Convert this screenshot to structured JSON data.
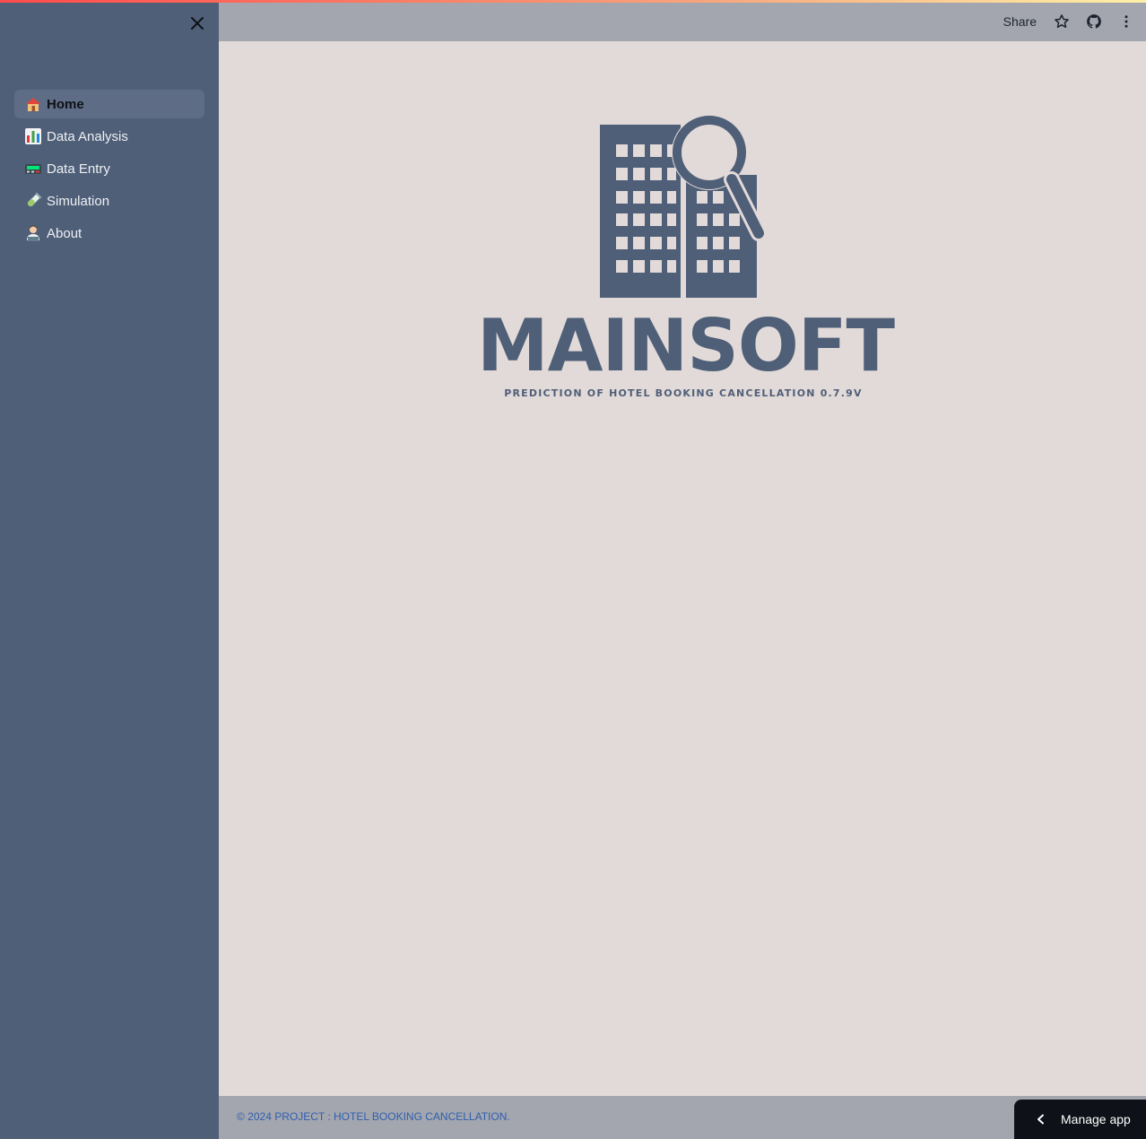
{
  "sidebar": {
    "close_icon": "close-icon",
    "items": [
      {
        "label": "Home",
        "icon": "house-emoji",
        "active": true
      },
      {
        "label": "Data Analysis",
        "icon": "bar-chart-emoji",
        "active": false
      },
      {
        "label": "Data Entry",
        "icon": "pager-emoji",
        "active": false
      },
      {
        "label": "Simulation",
        "icon": "test-tube-emoji",
        "active": false
      },
      {
        "label": "About",
        "icon": "technologist-emoji",
        "active": false
      }
    ]
  },
  "header": {
    "share_label": "Share",
    "icons": [
      "star-icon",
      "github-icon",
      "more-vertical-icon"
    ]
  },
  "logo": {
    "title": "MAINSOFT",
    "subtitle": "PREDICTION OF HOTEL BOOKING CANCELLATION 0.7.9V",
    "image": "hotel-building-with-magnifier"
  },
  "footer": {
    "copyright": "© 2024 PROJECT : HOTEL BOOKING CANCELLATION."
  },
  "manage_app": {
    "label": "Manage app",
    "icon": "chevron-left-icon"
  },
  "colors": {
    "sidebar_bg": "#4f5f78",
    "main_bg": "#e2dad8",
    "header_bg": "#a3a6ae",
    "logo": "#4f5f78",
    "footer_link": "#2f5fb0"
  }
}
